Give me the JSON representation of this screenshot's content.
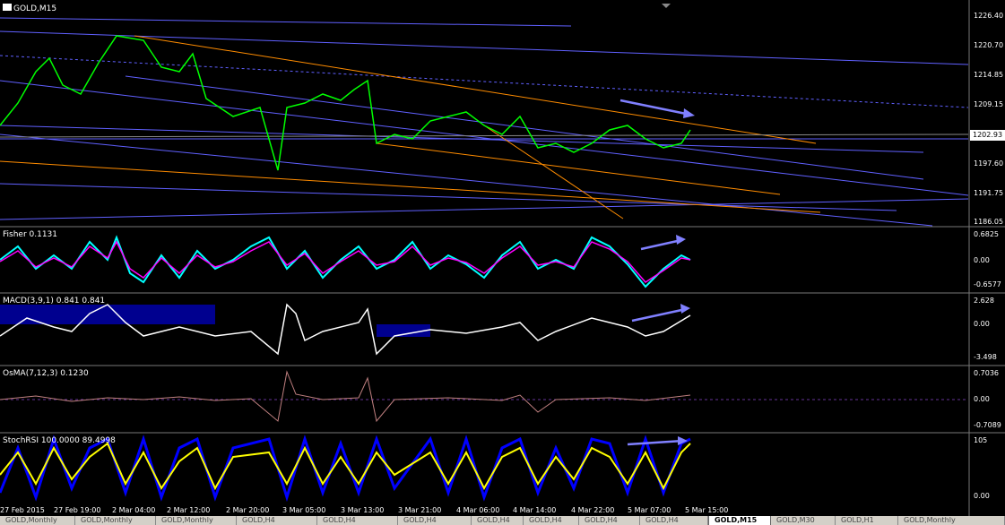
{
  "main": {
    "symbol_title": "GOLD,M15",
    "price_ticks": [
      "1226.40",
      "1220.70",
      "1214.85",
      "1209.15",
      "1202.93",
      "1197.60",
      "1191.75",
      "1186.05"
    ],
    "current_price": "1202.93"
  },
  "indicators": [
    {
      "label": "Fisher 0.1131",
      "ticks": [
        "0.6825",
        "0.00",
        "-0.6577"
      ]
    },
    {
      "label": "MACD(3,9,1) 0.841 0.841",
      "ticks": [
        "2.628",
        "0.00",
        "-3.498"
      ]
    },
    {
      "label": "OsMA(7,12,3) 0.1230",
      "ticks": [
        "0.7036",
        "0.00",
        "-0.7089"
      ]
    },
    {
      "label": "StochRSI 100.0000 89.4998",
      "ticks": [
        "105",
        "0.00"
      ]
    }
  ],
  "time_axis": [
    "27 Feb 2015",
    "27 Feb 19:00",
    "2 Mar 04:00",
    "2 Mar 12:00",
    "2 Mar 20:00",
    "3 Mar 05:00",
    "3 Mar 13:00",
    "3 Mar 21:00",
    "4 Mar 06:00",
    "4 Mar 14:00",
    "4 Mar 22:00",
    "5 Mar 07:00",
    "5 Mar 15:00"
  ],
  "tabs": [
    "GOLD,Monthly",
    "GOLD,Monthly",
    "GOLD,Monthly",
    "GOLD,H4",
    "GOLD,H4",
    "GOLD,H4",
    "GOLD,H4",
    "GOLD,H4",
    "GOLD,H4",
    "GOLD,H4",
    "GOLD,M15",
    "GOLD,M30",
    "GOLD,H1",
    "GOLD,Monthly"
  ],
  "active_tab_index": 10,
  "colors": {
    "background": "#000000",
    "candles": "#00ff00",
    "trendline_blue": "#6060ff",
    "trendline_orange": "#ff8c00",
    "fisher_cyan": "#00ffff",
    "fisher_magenta": "#ff00ff",
    "macd_blue": "#0000ff",
    "stoch_yellow": "#ffff00",
    "arrow": "#8080ff"
  }
}
